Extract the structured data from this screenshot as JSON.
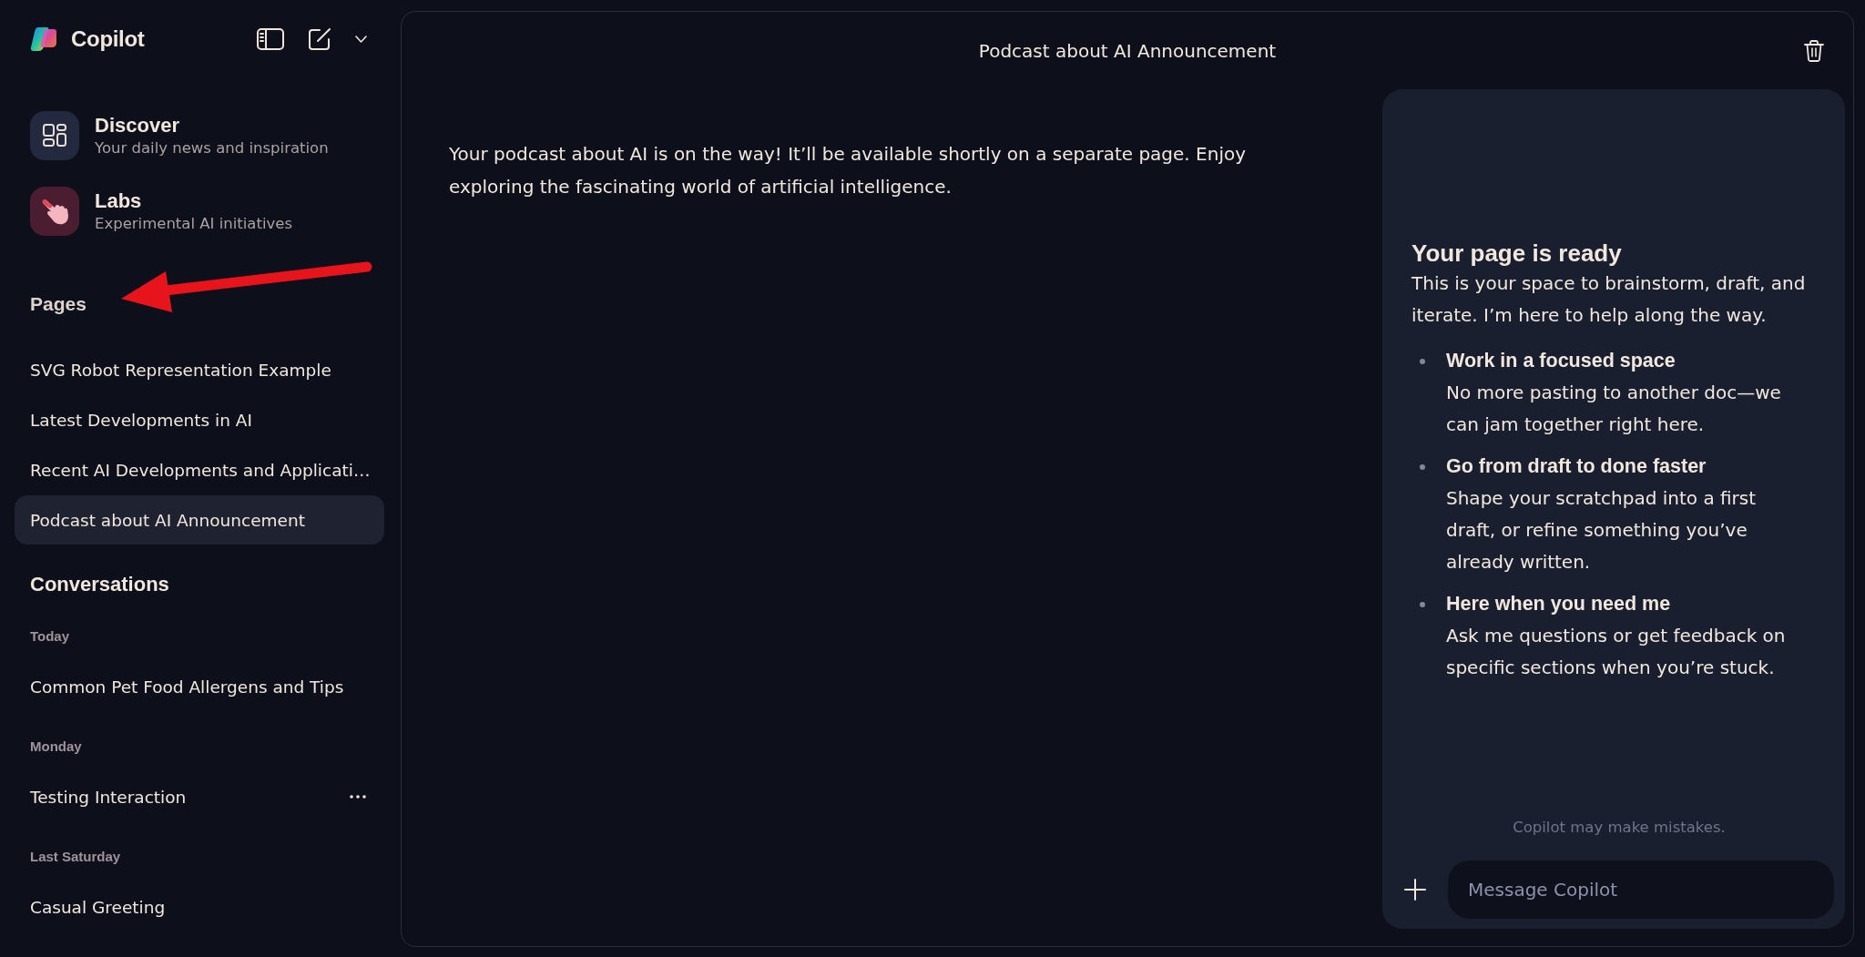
{
  "sidebar": {
    "brand": "Copilot",
    "nav": [
      {
        "kind": "discover",
        "title": "Discover",
        "subtitle": "Your daily news and inspiration"
      },
      {
        "kind": "labs",
        "title": "Labs",
        "subtitle": "Experimental AI initiatives"
      }
    ],
    "pages": {
      "heading": "Pages",
      "items": [
        {
          "label": "SVG Robot Representation Example",
          "selected": false
        },
        {
          "label": "Latest Developments in AI",
          "selected": false
        },
        {
          "label": "Recent AI Developments and Applicati…",
          "selected": false
        },
        {
          "label": "Podcast about AI Announcement",
          "selected": true
        }
      ]
    },
    "conversations": {
      "heading": "Conversations",
      "groups": [
        {
          "label": "Today",
          "items": [
            {
              "label": "Common Pet Food Allergens and Tips",
              "hovered": false
            }
          ]
        },
        {
          "label": "Monday",
          "items": [
            {
              "label": "Testing Interaction",
              "hovered": true
            }
          ]
        },
        {
          "label": "Last Saturday",
          "items": [
            {
              "label": "Casual Greeting",
              "hovered": false
            }
          ]
        }
      ]
    }
  },
  "header": {
    "title": "Podcast about AI Announcement"
  },
  "chat": {
    "messages": [
      {
        "text": "Your podcast about AI is on the way! It’ll be available shortly on a separate page. Enjoy exploring the fascinating world of artificial intelligence."
      }
    ]
  },
  "page_panel": {
    "title": "Your page is ready",
    "intro": "This is your space to brainstorm, draft, and iterate. I’m here to help along the way.",
    "features": [
      {
        "title": "Work in a focused space",
        "description": "No more pasting to another doc—we can jam together right here."
      },
      {
        "title": "Go from draft to done faster",
        "description": "Shape your scratchpad into a first draft, or refine something you’ve already written."
      },
      {
        "title": "Here when you need me",
        "description": "Ask me questions or get feedback on specific sections when you’re stuck."
      }
    ],
    "disclaimer": "Copilot may make mistakes.",
    "composer": {
      "placeholder": "Message Copilot"
    }
  }
}
